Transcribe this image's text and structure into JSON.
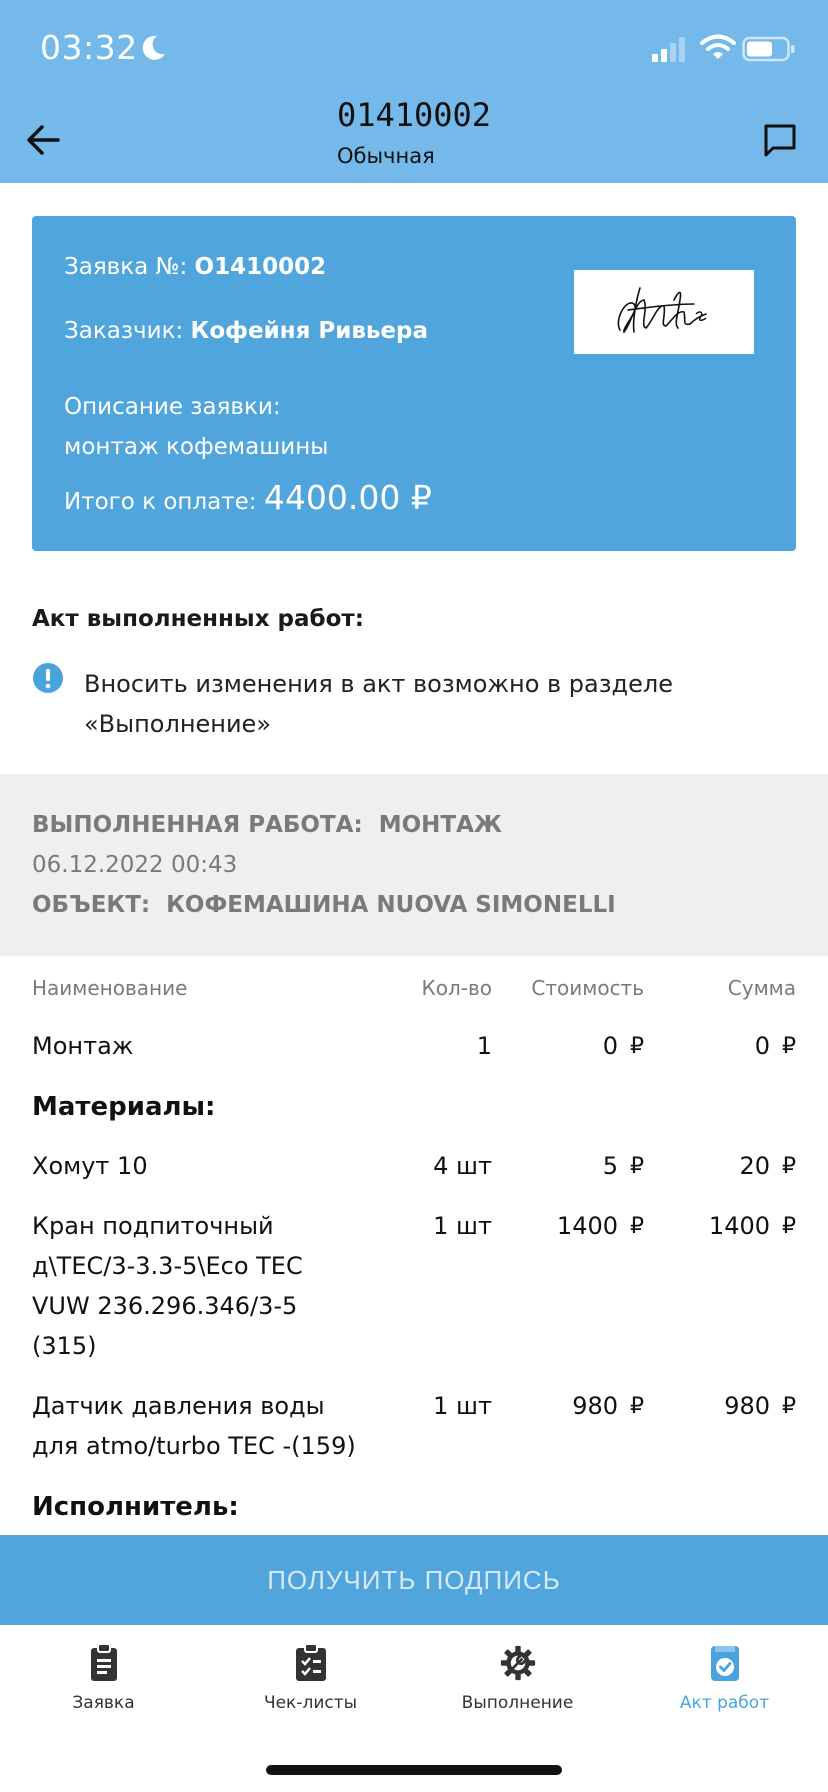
{
  "status_bar": {
    "time": "03:32"
  },
  "header": {
    "order_number": "01410002",
    "order_type": "Обычная"
  },
  "card": {
    "order_label": "Заявка №:",
    "order_value": "O1410002",
    "customer_label": "Заказчик:",
    "customer_value": "Кофейня Ривьера",
    "description_label": "Описание заявки:",
    "description_value": "монтаж кофемашины",
    "total_label": "Итого к оплате:",
    "total_value": "4400.00 ₽"
  },
  "act": {
    "title": "Акт выполненных работ:",
    "note": "Вносить изменения в акт возможно в разделе «Выполнение»"
  },
  "work": {
    "label": "ВЫПОЛНЕННАЯ РАБОТА:",
    "value": "МОНТАЖ",
    "datetime": "06.12.2022 00:43",
    "object_label": "ОБЪЕКТ:",
    "object_value": "КОФЕМАШИНА NUOVA SIMONELLI"
  },
  "table": {
    "headers": {
      "name": "Наименование",
      "qty": "Кол-во",
      "price": "Стоимость",
      "sum": "Сумма"
    },
    "currency": "₽",
    "service": {
      "name": "Монтаж",
      "qty": "1",
      "price": "0",
      "sum": "0"
    },
    "materials_title": "Материалы:",
    "materials": [
      {
        "name": "Хомут 10",
        "qty": "4 шт",
        "price": "5",
        "sum": "20"
      },
      {
        "name_lines": [
          "Кран подпиточный",
          "д\\TEC/3-3.3-5\\Eco TEC",
          "VUW 236.296.346/3-5",
          "(315)"
        ],
        "qty": "1 шт",
        "price": "1400",
        "sum": "1400"
      },
      {
        "name_lines": [
          "Датчик давления воды",
          "для atmo/turbo TEC -(159)"
        ],
        "qty": "1 шт",
        "price": "980",
        "sum": "980"
      }
    ],
    "executor_title": "Исполнитель:"
  },
  "sign_button": "ПОЛУЧИТЬ ПОДПИСЬ",
  "tabs": [
    {
      "label": "Заявка",
      "icon": "clipboard-list-icon"
    },
    {
      "label": "Чек-листы",
      "icon": "clipboard-check-icon"
    },
    {
      "label": "Выполнение",
      "icon": "gear-wrench-icon"
    },
    {
      "label": "Акт работ",
      "icon": "document-check-icon",
      "active": true
    }
  ],
  "colors": {
    "header": "#74b9ea",
    "card": "#50a5dc",
    "accent": "#4aa3dc",
    "grey_block": "#efefef"
  }
}
